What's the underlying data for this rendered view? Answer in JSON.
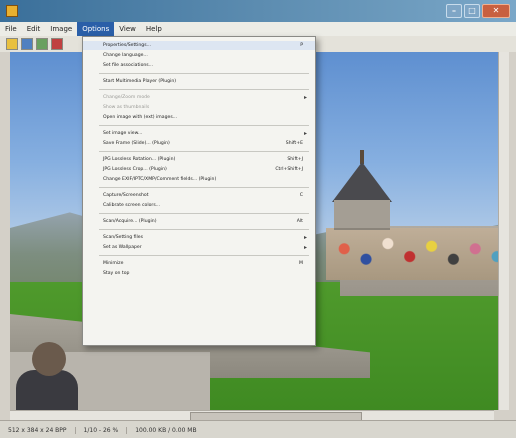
{
  "window": {
    "title": "",
    "minimize_label": "–",
    "maximize_label": "□",
    "close_label": "✕"
  },
  "menubar": {
    "items": [
      {
        "label": "File"
      },
      {
        "label": "Edit"
      },
      {
        "label": "Image"
      },
      {
        "label": "Options"
      },
      {
        "label": "View"
      },
      {
        "label": "Help"
      }
    ]
  },
  "options_menu": {
    "items": [
      {
        "label": "Properties/Settings...",
        "shortcut": "P",
        "submenu": false,
        "disabled": false
      },
      {
        "label": "Change language...",
        "shortcut": "",
        "submenu": false,
        "disabled": false
      },
      {
        "label": "Set file associations...",
        "shortcut": "",
        "submenu": false,
        "disabled": false
      },
      {
        "label": "Start Multimedia Player (Plugin)",
        "shortcut": "",
        "submenu": false,
        "disabled": false
      },
      {
        "label": "Change/Zoom mode",
        "shortcut": "",
        "submenu": true,
        "disabled": true
      },
      {
        "label": "Show as thumbnails",
        "shortcut": "",
        "submenu": false,
        "disabled": true
      },
      {
        "label": "Open image with (ext) images...",
        "shortcut": "",
        "submenu": false,
        "disabled": false
      },
      {
        "label": "Set image view...",
        "shortcut": "",
        "submenu": true,
        "disabled": false
      },
      {
        "label": "Save Frame (Slide)... (Plugin)",
        "shortcut": "Shift+E",
        "submenu": false,
        "disabled": false
      },
      {
        "label": "JPG Lossless Rotation... (Plugin)",
        "shortcut": "Shift+J",
        "submenu": false,
        "disabled": false
      },
      {
        "label": "JPG Lossless Crop... (Plugin)",
        "shortcut": "Ctrl+Shift+J",
        "submenu": false,
        "disabled": false
      },
      {
        "label": "Change EXIF/IPTC/XMP/Comment fields... (Plugin)",
        "shortcut": "",
        "submenu": false,
        "disabled": false
      },
      {
        "label": "Capture/Screenshot",
        "shortcut": "C",
        "submenu": false,
        "disabled": false
      },
      {
        "label": "Calibrate screen colors...",
        "shortcut": "",
        "submenu": false,
        "disabled": false
      },
      {
        "label": "Scan/Acquire... (Plugin)",
        "shortcut": "Alt",
        "submenu": false,
        "disabled": false
      },
      {
        "label": "Scan/Setting files",
        "shortcut": "",
        "submenu": true,
        "disabled": false
      },
      {
        "label": "Set as Wallpaper",
        "shortcut": "",
        "submenu": true,
        "disabled": false
      },
      {
        "label": "Minimize",
        "shortcut": "M",
        "submenu": false,
        "disabled": false
      },
      {
        "label": "Stay on top",
        "shortcut": "",
        "submenu": false,
        "disabled": false
      }
    ]
  },
  "statusbar": {
    "seg1": "512 x 384 x 24 BPP",
    "seg2": "1/10 - 26 %",
    "seg3": "100.00 KB / 0.00 MB"
  }
}
